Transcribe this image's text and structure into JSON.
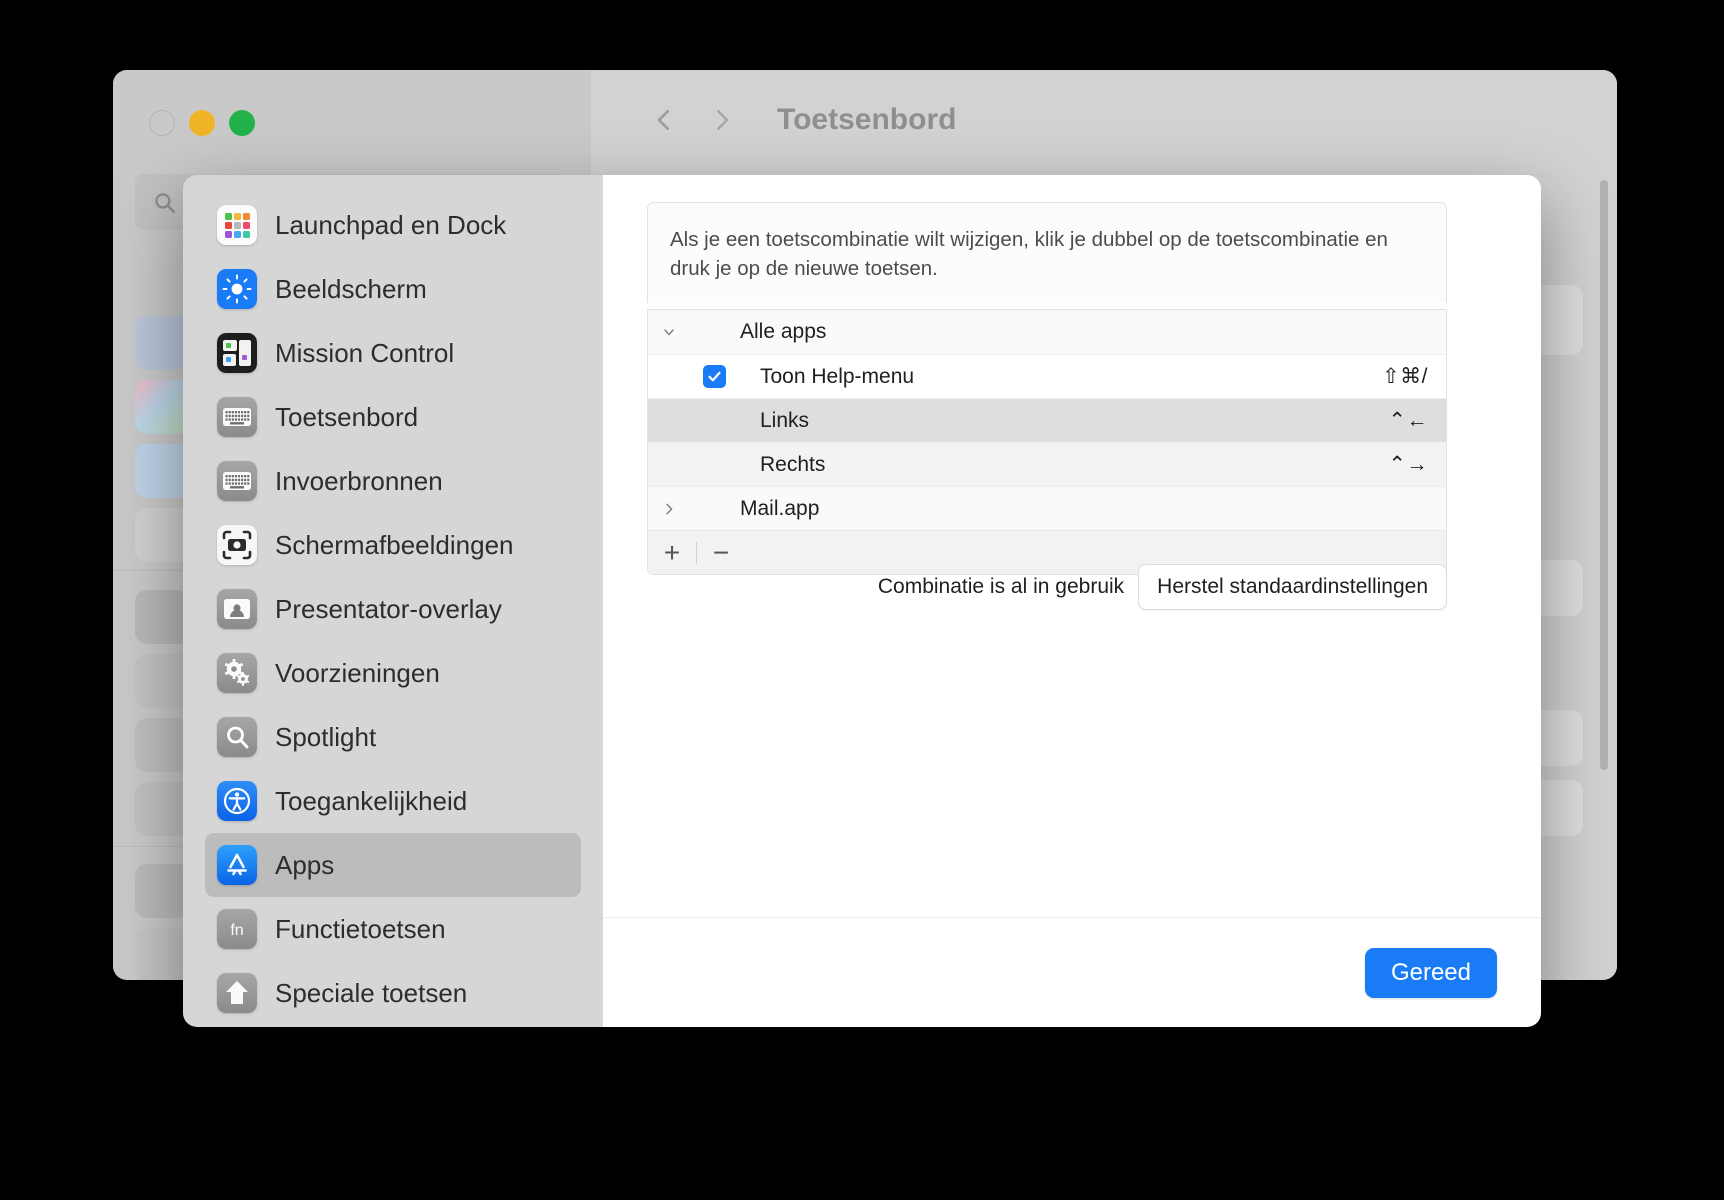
{
  "background_window": {
    "traffic_lights": [
      "close",
      "minimize",
      "maximize"
    ],
    "nav": {
      "back_label": "‹",
      "forward_label": "›",
      "title": "Toetsenbord"
    },
    "search": {
      "placeholder": "",
      "value": ""
    }
  },
  "sheet": {
    "sidebar": {
      "items": [
        {
          "label": "Launchpad en Dock",
          "icon": "launchpad-icon",
          "selected": false
        },
        {
          "label": "Beeldscherm",
          "icon": "display-icon",
          "selected": false
        },
        {
          "label": "Mission Control",
          "icon": "mission-control-icon",
          "selected": false
        },
        {
          "label": "Toetsenbord",
          "icon": "keyboard-icon",
          "selected": false
        },
        {
          "label": "Invoerbronnen",
          "icon": "keyboard-icon",
          "selected": false
        },
        {
          "label": "Schermafbeeldingen",
          "icon": "camera-icon",
          "selected": false
        },
        {
          "label": "Presentator-overlay",
          "icon": "person-card-icon",
          "selected": false
        },
        {
          "label": "Voorzieningen",
          "icon": "gears-icon",
          "selected": false
        },
        {
          "label": "Spotlight",
          "icon": "search-icon",
          "selected": false
        },
        {
          "label": "Toegankelijkheid",
          "icon": "accessibility-icon",
          "selected": false
        },
        {
          "label": "Apps",
          "icon": "app-store-icon",
          "selected": true
        },
        {
          "label": "Functietoetsen",
          "icon": "fn-icon",
          "selected": false
        },
        {
          "label": "Speciale toetsen",
          "icon": "shift-arrow-icon",
          "selected": false
        }
      ]
    },
    "main": {
      "description": "Als je een toetscombinatie wilt wijzigen, klik je dubbel op de toetscombinatie en druk je op de nieuwe toetsen.",
      "rows": [
        {
          "type": "group",
          "label": "Alle apps",
          "shortcut": "",
          "disclosure": "chevron-down-icon",
          "checkbox": null,
          "state": "group"
        },
        {
          "type": "item",
          "label": "Toon Help-menu",
          "shortcut": "⇧⌘/",
          "disclosure": "",
          "checkbox": true,
          "state": "plain"
        },
        {
          "type": "item",
          "label": "Links",
          "shortcut": "⌃←",
          "disclosure": "",
          "checkbox": null,
          "state": "sel"
        },
        {
          "type": "item",
          "label": "Rechts",
          "shortcut": "⌃→",
          "disclosure": "",
          "checkbox": null,
          "state": "alt"
        },
        {
          "type": "group",
          "label": "Mail.app",
          "shortcut": "",
          "disclosure": "chevron-right-icon",
          "checkbox": null,
          "state": "group"
        }
      ],
      "toolbar": {
        "add_label": "+",
        "remove_label": "−"
      },
      "status_text": "Combinatie is al in gebruik",
      "reset_label": "Herstel standaardinstellingen",
      "done_label": "Gereed"
    }
  },
  "colors": {
    "accent": "#1a7bf7",
    "sheet_sidebar": "#d6d6d6",
    "selected_row": "#dedede",
    "window_chrome": "#cbcbcb"
  }
}
